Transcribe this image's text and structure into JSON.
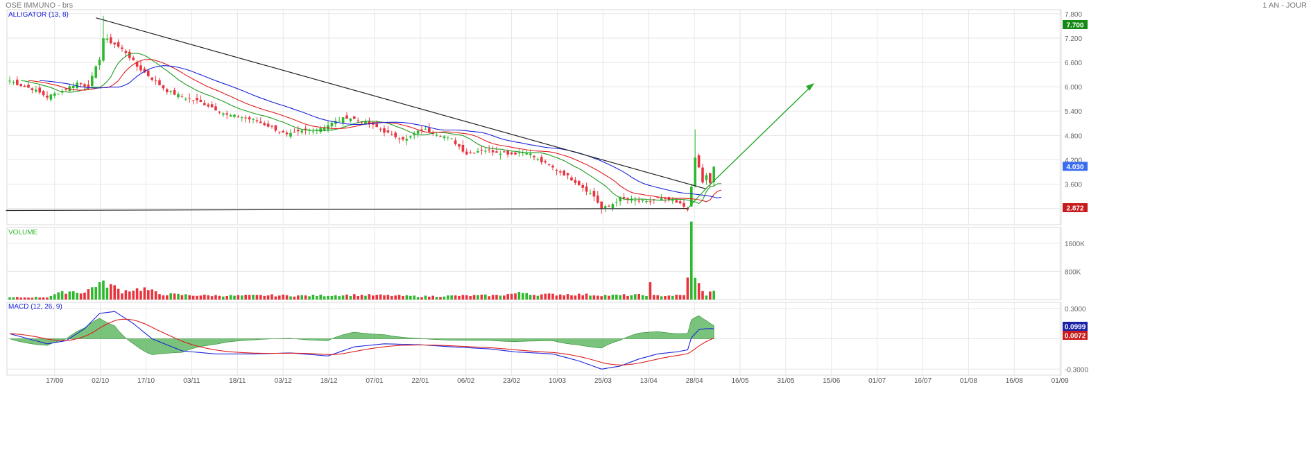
{
  "header": {
    "title": "OSE IMMUNO - brs",
    "period": "1 AN - JOUR"
  },
  "colors": {
    "up": "#2eb82e",
    "down": "#e8343e",
    "alligator_green": "#1e9a1e",
    "alligator_red": "#dd1c1c",
    "alligator_blue": "#1a22d8",
    "macd_line": "#1a22d8",
    "signal_line": "#dd1c1c",
    "histogram": "#4caf50",
    "grid": "#e6e6e6",
    "trendline": "#222222",
    "arrow": "#27a827"
  },
  "chart_data": [
    {
      "type": "candlestick",
      "title": "ALLIGATOR (13, 8)",
      "ylim": [
        2.6,
        7.9
      ],
      "yticks": [
        "7.800",
        "7.200",
        "6.600",
        "6.000",
        "5.400",
        "4.800",
        "4.200",
        "3.600",
        "3.000"
      ],
      "last_price_label": "4.030",
      "high_label": "7.700",
      "low_label": "2.872",
      "x_tick_labels": [
        "17/09",
        "02/10",
        "17/10",
        "03/11",
        "18/11",
        "03/12",
        "18/12",
        "07/01",
        "22/01",
        "06/02",
        "23/02",
        "10/03",
        "25/03",
        "13/04",
        "28/04",
        "16/05",
        "31/05",
        "15/06",
        "01/07",
        "16/07",
        "01/08",
        "16/08",
        "01/09"
      ],
      "close_anchors": [
        [
          0,
          6.15
        ],
        [
          4,
          6.0
        ],
        [
          6,
          5.95
        ],
        [
          10,
          5.75
        ],
        [
          14,
          5.9
        ],
        [
          18,
          6.1
        ],
        [
          21,
          6.0
        ],
        [
          24,
          6.7
        ],
        [
          25,
          7.2
        ],
        [
          28,
          7.05
        ],
        [
          31,
          6.85
        ],
        [
          34,
          6.5
        ],
        [
          38,
          6.2
        ],
        [
          42,
          5.9
        ],
        [
          46,
          5.75
        ],
        [
          50,
          5.65
        ],
        [
          54,
          5.5
        ],
        [
          58,
          5.3
        ],
        [
          62,
          5.25
        ],
        [
          66,
          5.15
        ],
        [
          70,
          5.0
        ],
        [
          74,
          4.8
        ],
        [
          78,
          4.9
        ],
        [
          82,
          4.95
        ],
        [
          86,
          5.1
        ],
        [
          90,
          5.25
        ],
        [
          94,
          5.15
        ],
        [
          98,
          5.0
        ],
        [
          102,
          4.8
        ],
        [
          106,
          4.7
        ],
        [
          110,
          4.95
        ],
        [
          114,
          4.85
        ],
        [
          118,
          4.7
        ],
        [
          122,
          4.35
        ],
        [
          126,
          4.45
        ],
        [
          130,
          4.4
        ],
        [
          134,
          4.35
        ],
        [
          138,
          4.4
        ],
        [
          141,
          4.2
        ],
        [
          144,
          4.05
        ],
        [
          148,
          3.85
        ],
        [
          152,
          3.6
        ],
        [
          156,
          3.3
        ],
        [
          158,
          3.0
        ],
        [
          160,
          3.05
        ],
        [
          163,
          3.25
        ],
        [
          166,
          3.2
        ],
        [
          170,
          3.15
        ],
        [
          173,
          3.25
        ],
        [
          176,
          3.2
        ],
        [
          179,
          3.1
        ],
        [
          181,
          3.0
        ],
        [
          182,
          3.5
        ],
        [
          183,
          4.25
        ],
        [
          184,
          4.0
        ],
        [
          185,
          3.65
        ],
        [
          186,
          3.8
        ],
        [
          187,
          3.6
        ],
        [
          188,
          4.03
        ]
      ],
      "volume_anchors": [
        [
          0,
          60000
        ],
        [
          10,
          70000
        ],
        [
          12,
          150000
        ],
        [
          16,
          240000
        ],
        [
          20,
          200000
        ],
        [
          23,
          420000
        ],
        [
          24,
          460000
        ],
        [
          27,
          410000
        ],
        [
          30,
          230000
        ],
        [
          32,
          280000
        ],
        [
          36,
          310000
        ],
        [
          40,
          160000
        ],
        [
          50,
          120000
        ],
        [
          60,
          110000
        ],
        [
          70,
          120000
        ],
        [
          80,
          110000
        ],
        [
          90,
          130000
        ],
        [
          100,
          120000
        ],
        [
          110,
          90000
        ],
        [
          120,
          110000
        ],
        [
          130,
          120000
        ],
        [
          138,
          200000
        ],
        [
          140,
          140000
        ],
        [
          150,
          150000
        ],
        [
          160,
          120000
        ],
        [
          170,
          130000
        ],
        [
          171,
          420000
        ],
        [
          172,
          110000
        ],
        [
          180,
          120000
        ],
        [
          181,
          720000
        ],
        [
          182,
          1950000
        ],
        [
          183,
          570000
        ],
        [
          184,
          420000
        ],
        [
          185,
          300000
        ],
        [
          186,
          100000
        ],
        [
          187,
          200000
        ],
        [
          188,
          300000
        ]
      ],
      "macd_anchors": [
        [
          0,
          0.05
        ],
        [
          10,
          -0.05
        ],
        [
          15,
          -0.02
        ],
        [
          20,
          0.1
        ],
        [
          24,
          0.25
        ],
        [
          28,
          0.27
        ],
        [
          33,
          0.15
        ],
        [
          38,
          0.0
        ],
        [
          46,
          -0.12
        ],
        [
          55,
          -0.15
        ],
        [
          65,
          -0.15
        ],
        [
          75,
          -0.14
        ],
        [
          85,
          -0.17
        ],
        [
          92,
          -0.08
        ],
        [
          100,
          -0.05
        ],
        [
          110,
          -0.06
        ],
        [
          118,
          -0.08
        ],
        [
          128,
          -0.1
        ],
        [
          135,
          -0.13
        ],
        [
          145,
          -0.15
        ],
        [
          152,
          -0.22
        ],
        [
          158,
          -0.3
        ],
        [
          163,
          -0.27
        ],
        [
          168,
          -0.2
        ],
        [
          173,
          -0.15
        ],
        [
          178,
          -0.13
        ],
        [
          181,
          -0.11
        ],
        [
          182,
          0.01
        ],
        [
          184,
          0.09
        ],
        [
          186,
          0.1
        ],
        [
          188,
          0.1
        ]
      ],
      "alligator_lines": [
        "green",
        "red",
        "blue"
      ],
      "annotations": [
        "descending trendline",
        "support line",
        "breakout arrow"
      ]
    },
    {
      "type": "bar",
      "title": "VOLUME",
      "yticks": [
        "1600K",
        "800K"
      ],
      "ylim": [
        0,
        2050000
      ]
    },
    {
      "type": "line",
      "title": "MACD (12, 26, 9)",
      "yticks": [
        "0.3000",
        "-0.3000"
      ],
      "ylim": [
        -0.36,
        0.36
      ],
      "macd_label": "0.0999",
      "signal_label": "0.0072"
    }
  ]
}
